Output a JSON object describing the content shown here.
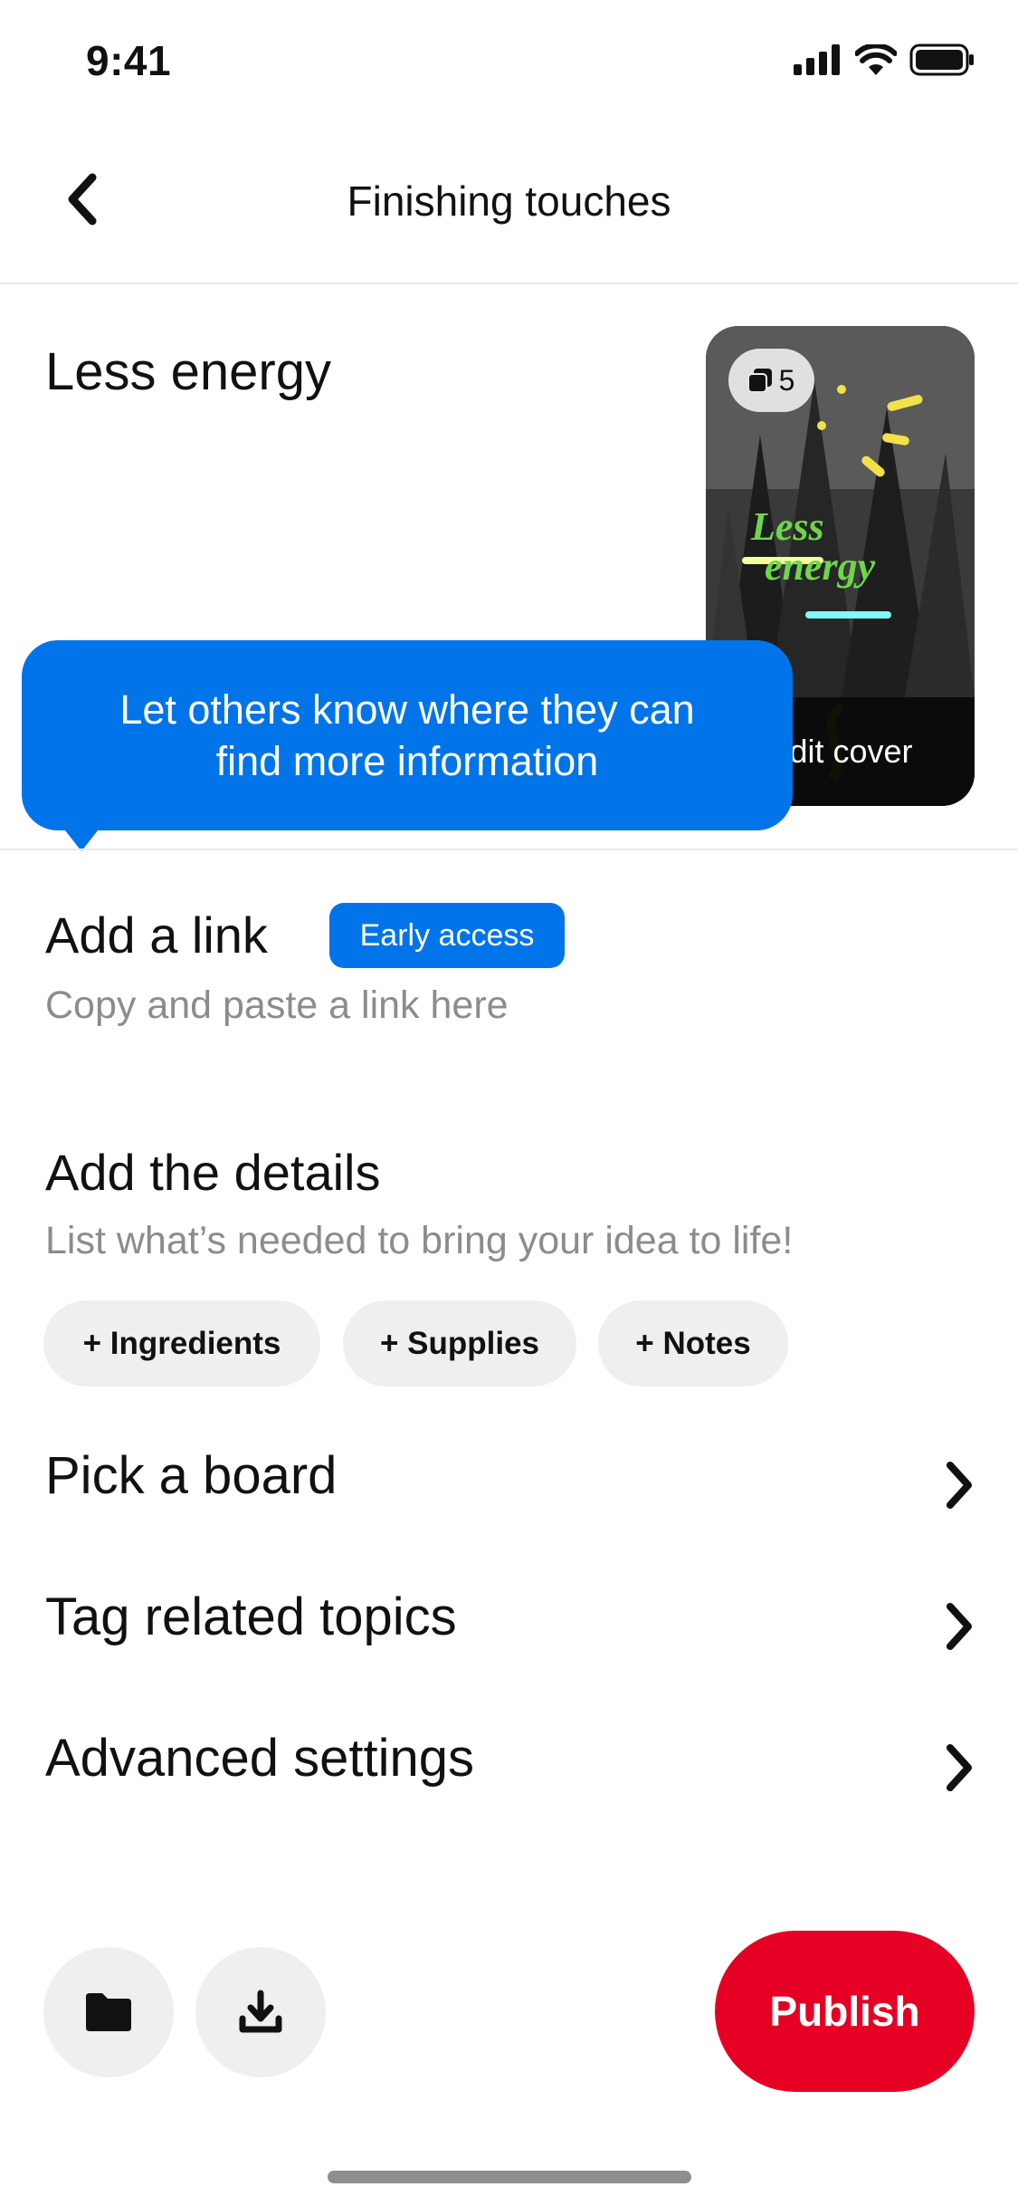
{
  "status_bar": {
    "time": "9:41"
  },
  "header": {
    "title": "Finishing touches"
  },
  "pin": {
    "title": "Less energy"
  },
  "cover": {
    "page_count": "5",
    "edit_label": "Edit cover",
    "overlay_text_line1": "Less",
    "overlay_text_line2": "energy"
  },
  "tooltip": {
    "line1": "Let others know where they can",
    "line2": "find more information"
  },
  "link_section": {
    "title": "Add a link",
    "badge": "Early access",
    "placeholder": "Copy and paste a link here"
  },
  "details_section": {
    "title": "Add the details",
    "subtitle": "List what’s needed to bring your idea to life!",
    "chips": [
      "+ Ingredients",
      "+ Supplies",
      "+ Notes"
    ]
  },
  "rows": [
    "Pick a board",
    "Tag related topics",
    "Advanced settings"
  ],
  "footer": {
    "publish_label": "Publish"
  },
  "colors": {
    "accent_blue": "#0074e8",
    "publish_red": "#e60023",
    "chip_bg": "#efefef"
  }
}
